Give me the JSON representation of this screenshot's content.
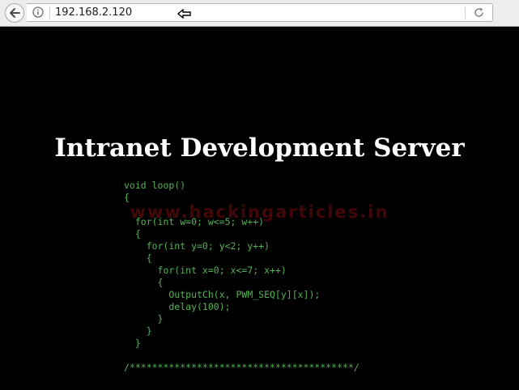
{
  "browser": {
    "url": "192.168.2.120"
  },
  "page": {
    "title": "Intranet Development Server",
    "watermark": "www.hackingarticles.in",
    "code_lines": [
      "void loop()",
      "{",
      "",
      "  for(int w=0; w<=5; w++)",
      "  {",
      "    for(int y=0; y<2; y++)",
      "    {",
      "      for(int x=0; x<=7; x++)",
      "      {",
      "        OutputCh(x, PWM_SEQ[y][x]);",
      "        delay(100);",
      "      }",
      "    }",
      "  }",
      "",
      "/****************************************/"
    ]
  },
  "colors": {
    "page_background": "#000000",
    "title": "#ffffff",
    "code": "#52b352",
    "watermark": "#7a0d0d"
  }
}
